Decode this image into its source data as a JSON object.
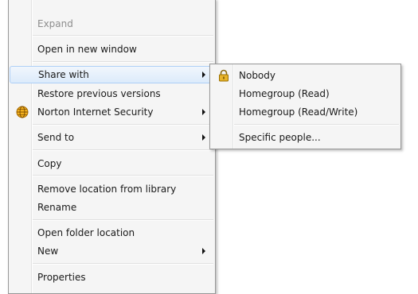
{
  "context_menu": {
    "items": {
      "expand": "Expand",
      "open_new_window": "Open in new window",
      "share_with": "Share with",
      "restore_previous": "Restore previous versions",
      "norton": "Norton Internet Security",
      "send_to": "Send to",
      "copy": "Copy",
      "remove_location": "Remove location from library",
      "rename": "Rename",
      "open_folder_location": "Open folder location",
      "new": "New",
      "properties": "Properties"
    }
  },
  "share_submenu": {
    "items": {
      "nobody": "Nobody",
      "homegroup_read": "Homegroup (Read)",
      "homegroup_readwrite": "Homegroup (Read/Write)",
      "specific_people": "Specific people..."
    }
  },
  "icons": {
    "norton": "norton-globe-icon",
    "nobody": "padlock-icon"
  },
  "colors": {
    "hover_bg": "#dcebfb",
    "hover_border": "#aecff7",
    "disabled_text": "#8d8d8d"
  }
}
